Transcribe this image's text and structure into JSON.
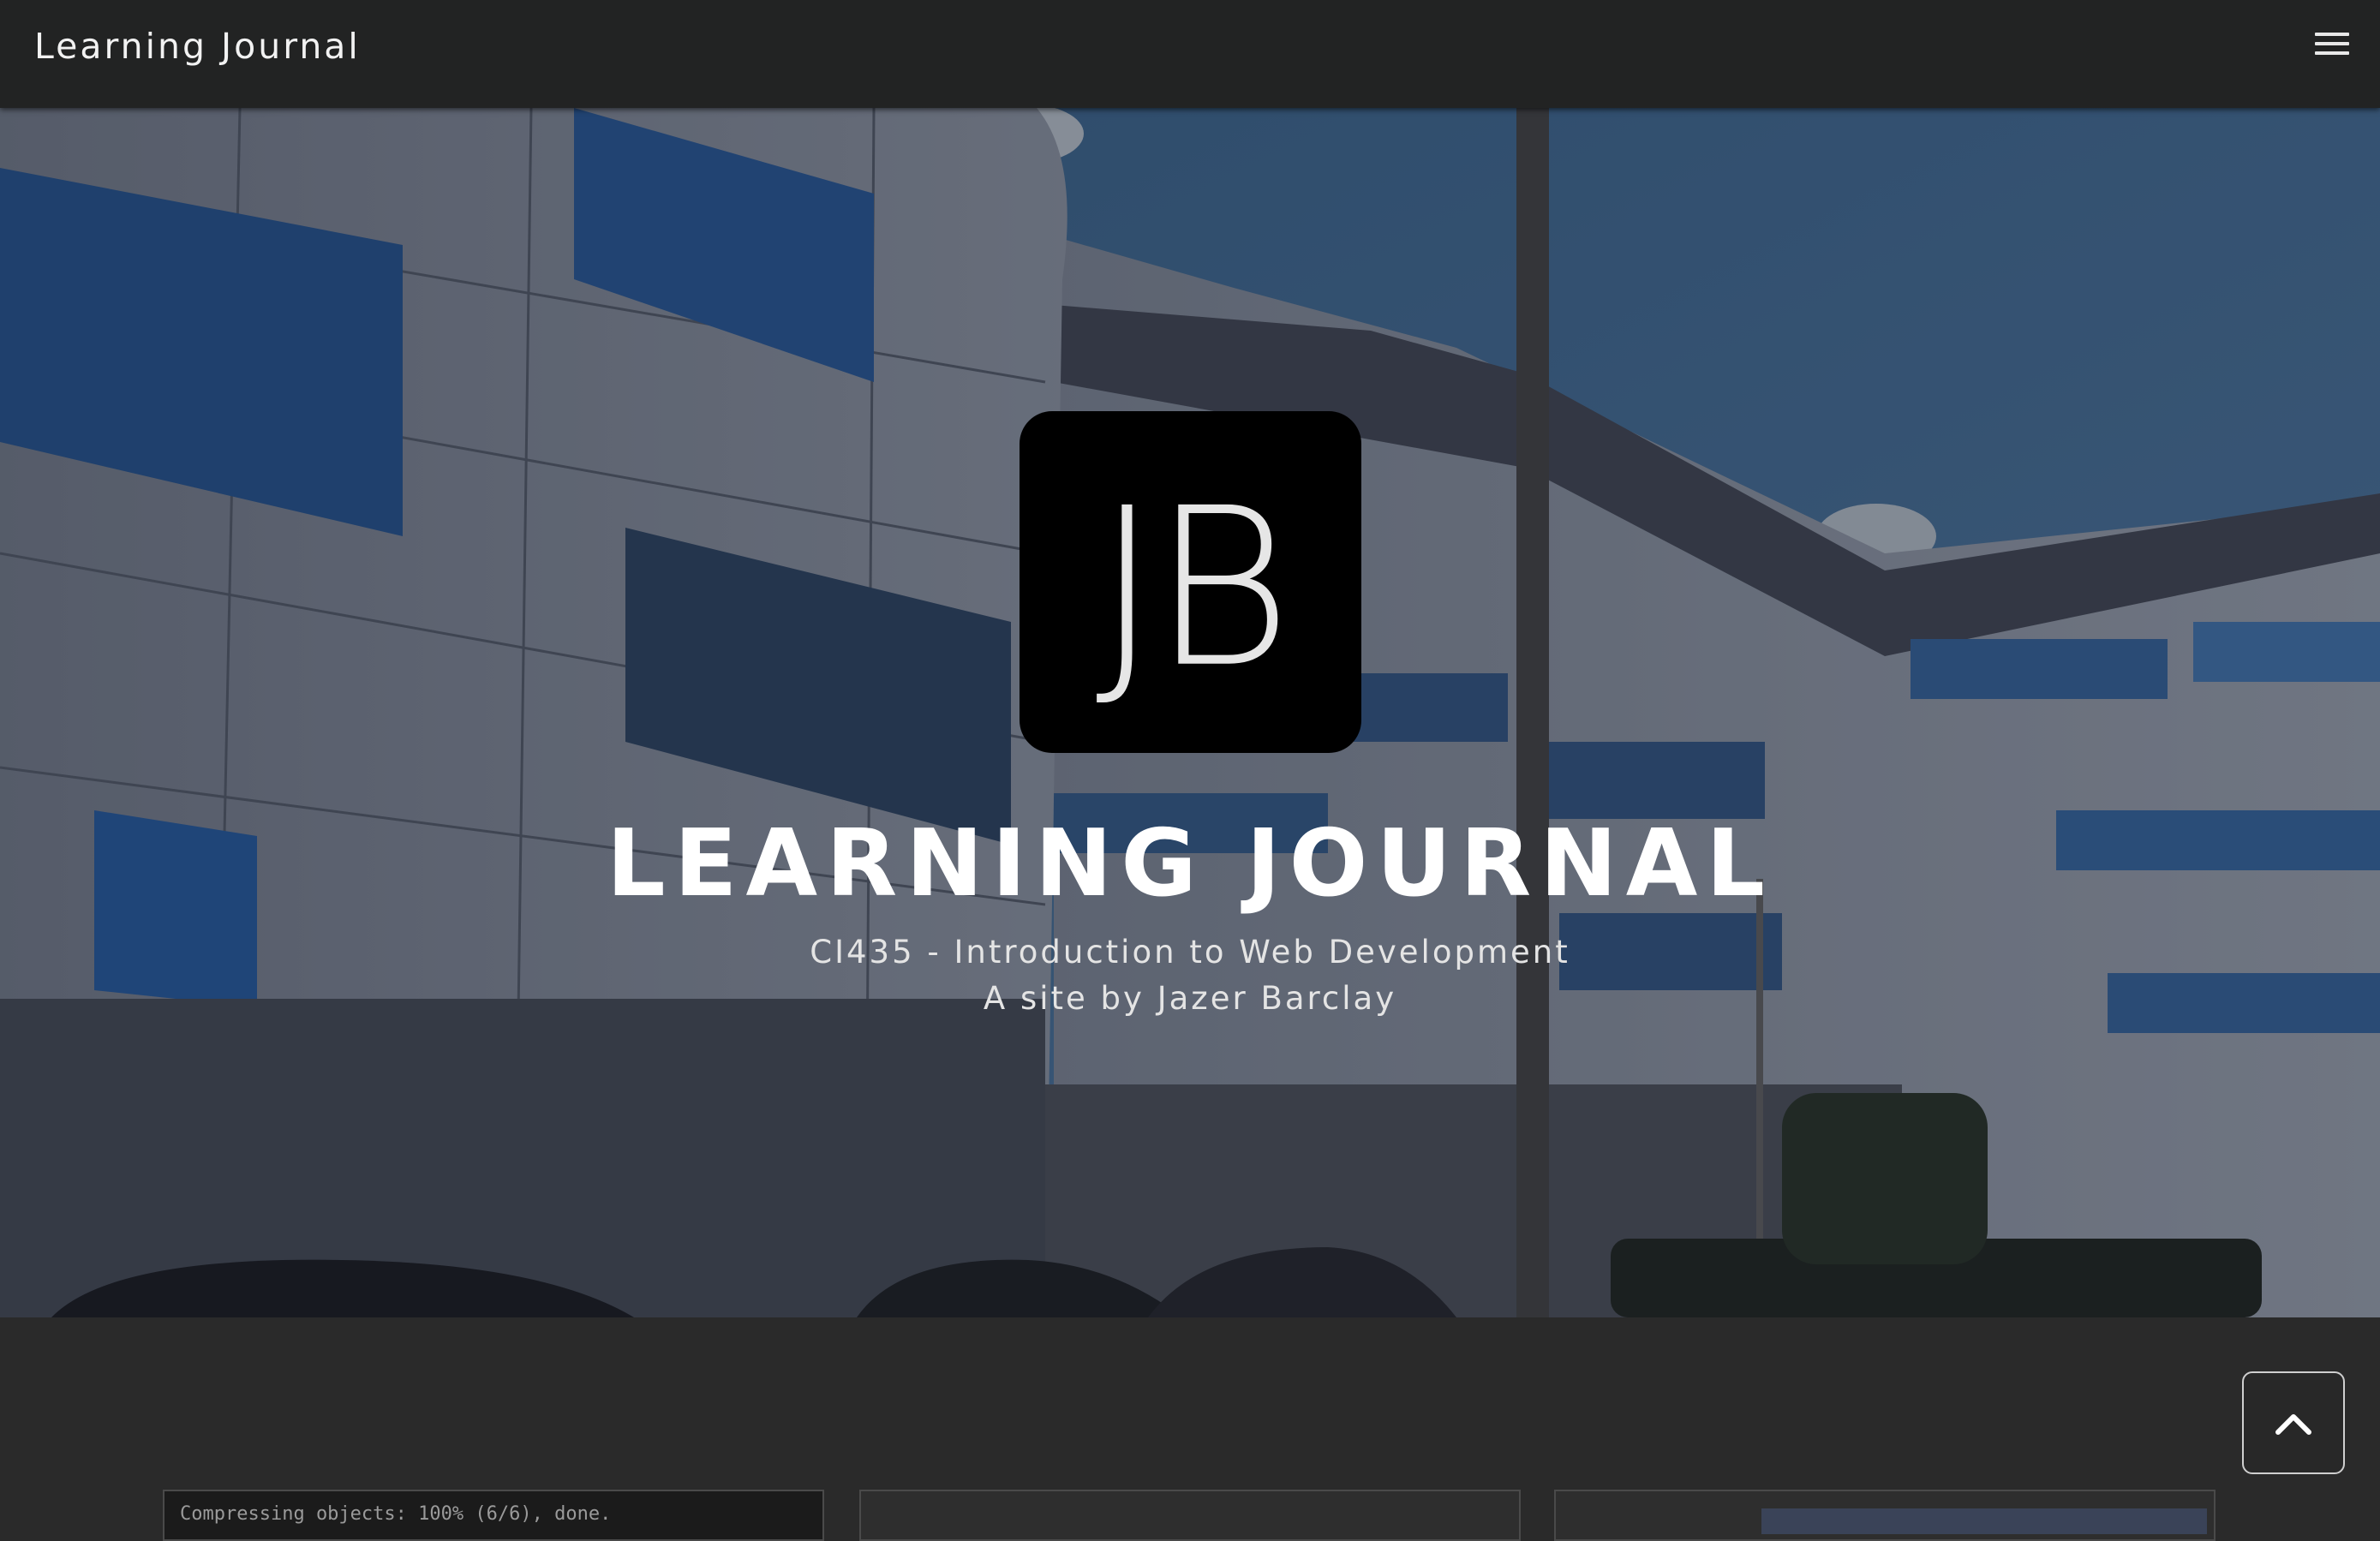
{
  "navbar": {
    "brand": "Learning Journal",
    "menu_icon": "hamburger-menu-icon"
  },
  "hero": {
    "logo_text": "JB",
    "title": "LEARNING JOURNAL",
    "subtitle_line1": "CI435 - Introduction to Web Development",
    "subtitle_line2": "A site by Jazer Barclay",
    "background_image": "university-building-photo"
  },
  "cards": [
    {
      "snippet": "Compressing objects: 100% (6/6), done."
    },
    {
      "snippet": ""
    },
    {
      "snippet": ""
    }
  ],
  "back_to_top": {
    "icon": "chevron-up-icon"
  },
  "colors": {
    "navbar_bg": "#222323",
    "page_bg": "#2a2a2a",
    "logo_bg": "#000000",
    "text": "#ffffff"
  }
}
